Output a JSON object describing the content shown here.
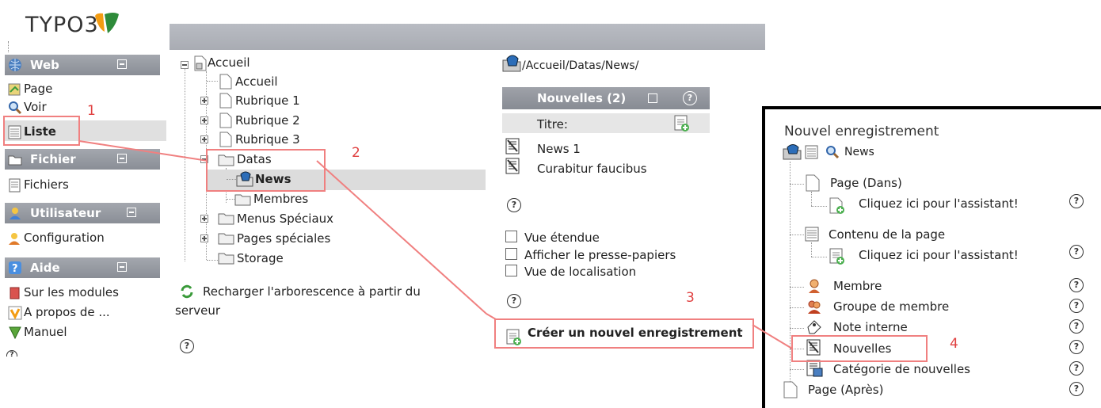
{
  "logo": {
    "text": "TYPO3"
  },
  "modules": {
    "web": {
      "title": "Web",
      "items": [
        "Page",
        "Voir",
        "Liste"
      ]
    },
    "fichier": {
      "title": "Fichier",
      "items": [
        "Fichiers"
      ]
    },
    "utilisateur": {
      "title": "Utilisateur",
      "items": [
        "Configuration"
      ]
    },
    "aide": {
      "title": "Aide",
      "items": [
        "Sur les modules",
        "A propos de ...",
        "Manuel"
      ]
    }
  },
  "tree": {
    "root": "Accueil",
    "items": [
      "Accueil",
      "Rubrique 1",
      "Rubrique 2",
      "Rubrique 3",
      "Datas",
      "News",
      "Membres",
      "Menus Spéciaux",
      "Pages spéciales",
      "Storage"
    ],
    "reload_line1": "Recharger l'arborescence à partir du",
    "reload_line2": "serveur"
  },
  "list": {
    "path": "/Accueil/Datas/News/",
    "table_title": "Nouvelles (2)",
    "col_title": "Titre:",
    "rows": [
      "News 1",
      "Curabitur faucibus"
    ],
    "options": [
      "Vue étendue",
      "Afficher le presse-papiers",
      "Vue de localisation"
    ],
    "create_new": "Créer un nouvel enregistrement"
  },
  "popup": {
    "title": "Nouvel enregistrement",
    "context": "News",
    "page_in": "Page (Dans)",
    "wizard1": "Cliquez ici pour l'assistant!",
    "content": "Contenu de la page",
    "wizard2": "Cliquez ici pour l'assistant!",
    "records": [
      "Membre",
      "Groupe de membre",
      "Note interne",
      "Nouvelles",
      "Catégorie de nouvelles"
    ],
    "page_after": "Page (Après)"
  },
  "annotations": [
    "1",
    "2",
    "3",
    "4"
  ],
  "help_glyph": "?",
  "colors": {
    "annotation": "#f08080",
    "header": "#8a8e96",
    "selected": "#e0e0e0"
  }
}
